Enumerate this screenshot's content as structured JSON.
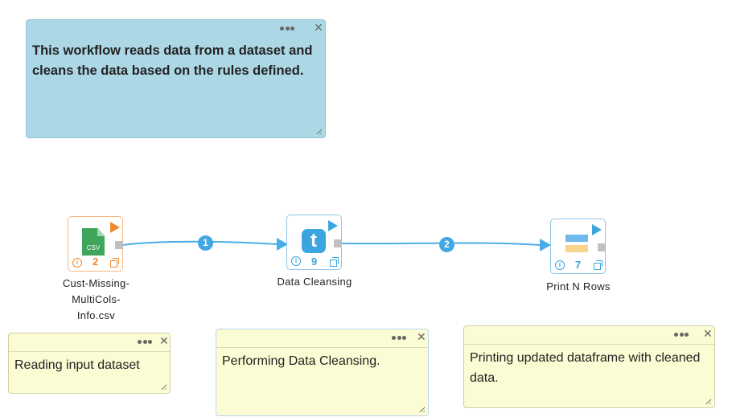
{
  "notes": [
    {
      "text": "This workflow reads data from a dataset and cleans the data based on the rules defined."
    },
    {
      "text": "Reading input dataset"
    },
    {
      "text": "Performing Data Cleansing."
    },
    {
      "text": "Printing updated dataframe with cleaned data."
    }
  ],
  "nodes": [
    {
      "label": "Cust-Missing-MultiCols-Info.csv",
      "icon": "csv-file-icon",
      "icon_text": "CSV",
      "count": "2",
      "color": "#f08a2c"
    },
    {
      "label": "Data Cleansing",
      "icon": "transform-t-icon",
      "icon_text": "t",
      "count": "9",
      "color": "#3ba5e0"
    },
    {
      "label": "Print N Rows",
      "icon": "print-rows-icon",
      "count": "7",
      "color": "#3ba5e0"
    }
  ],
  "edges": [
    {
      "badge": "1"
    },
    {
      "badge": "2"
    }
  ],
  "colors": {
    "edge": "#4aaee6",
    "note_blue": "#acd8e6",
    "note_yellow": "#fcfcd4",
    "csv_green": "#3ea55a"
  }
}
